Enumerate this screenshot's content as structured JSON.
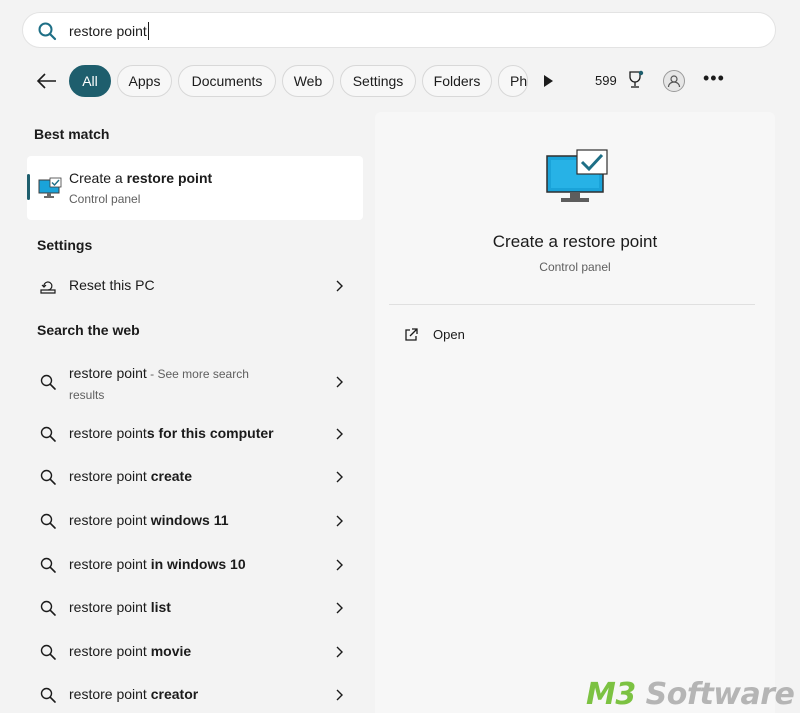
{
  "search": {
    "value": "restore point"
  },
  "filters": {
    "chips": [
      "All",
      "Apps",
      "Documents",
      "Web",
      "Settings",
      "Folders",
      "Ph"
    ],
    "points": "599"
  },
  "best_match": {
    "heading": "Best match",
    "title_prefix": "Create a ",
    "title_bold": "restore point",
    "subtitle": "Control panel"
  },
  "settings": {
    "heading": "Settings",
    "item": "Reset this PC"
  },
  "web": {
    "heading": "Search the web",
    "first": {
      "query": "restore point",
      "suffix": " - See more search",
      "suffix2": "results"
    },
    "items": [
      {
        "prefix": "restore point",
        "bold": "s for this computer"
      },
      {
        "prefix": "restore point ",
        "bold": "create"
      },
      {
        "prefix": "restore point ",
        "bold": "windows 11"
      },
      {
        "prefix": "restore point ",
        "bold": "in windows 10"
      },
      {
        "prefix": "restore point ",
        "bold": "list"
      },
      {
        "prefix": "restore point ",
        "bold": "movie"
      },
      {
        "prefix": "restore point ",
        "bold": "creator"
      }
    ]
  },
  "detail": {
    "title": "Create a restore point",
    "subtitle": "Control panel",
    "action": "Open"
  },
  "watermark": {
    "brand_a": "M3",
    "brand_b": " Software"
  },
  "colors": {
    "accent": "#1e5e6d",
    "monitor": "#1aa3d9",
    "watermark_green": "#7cc242"
  }
}
